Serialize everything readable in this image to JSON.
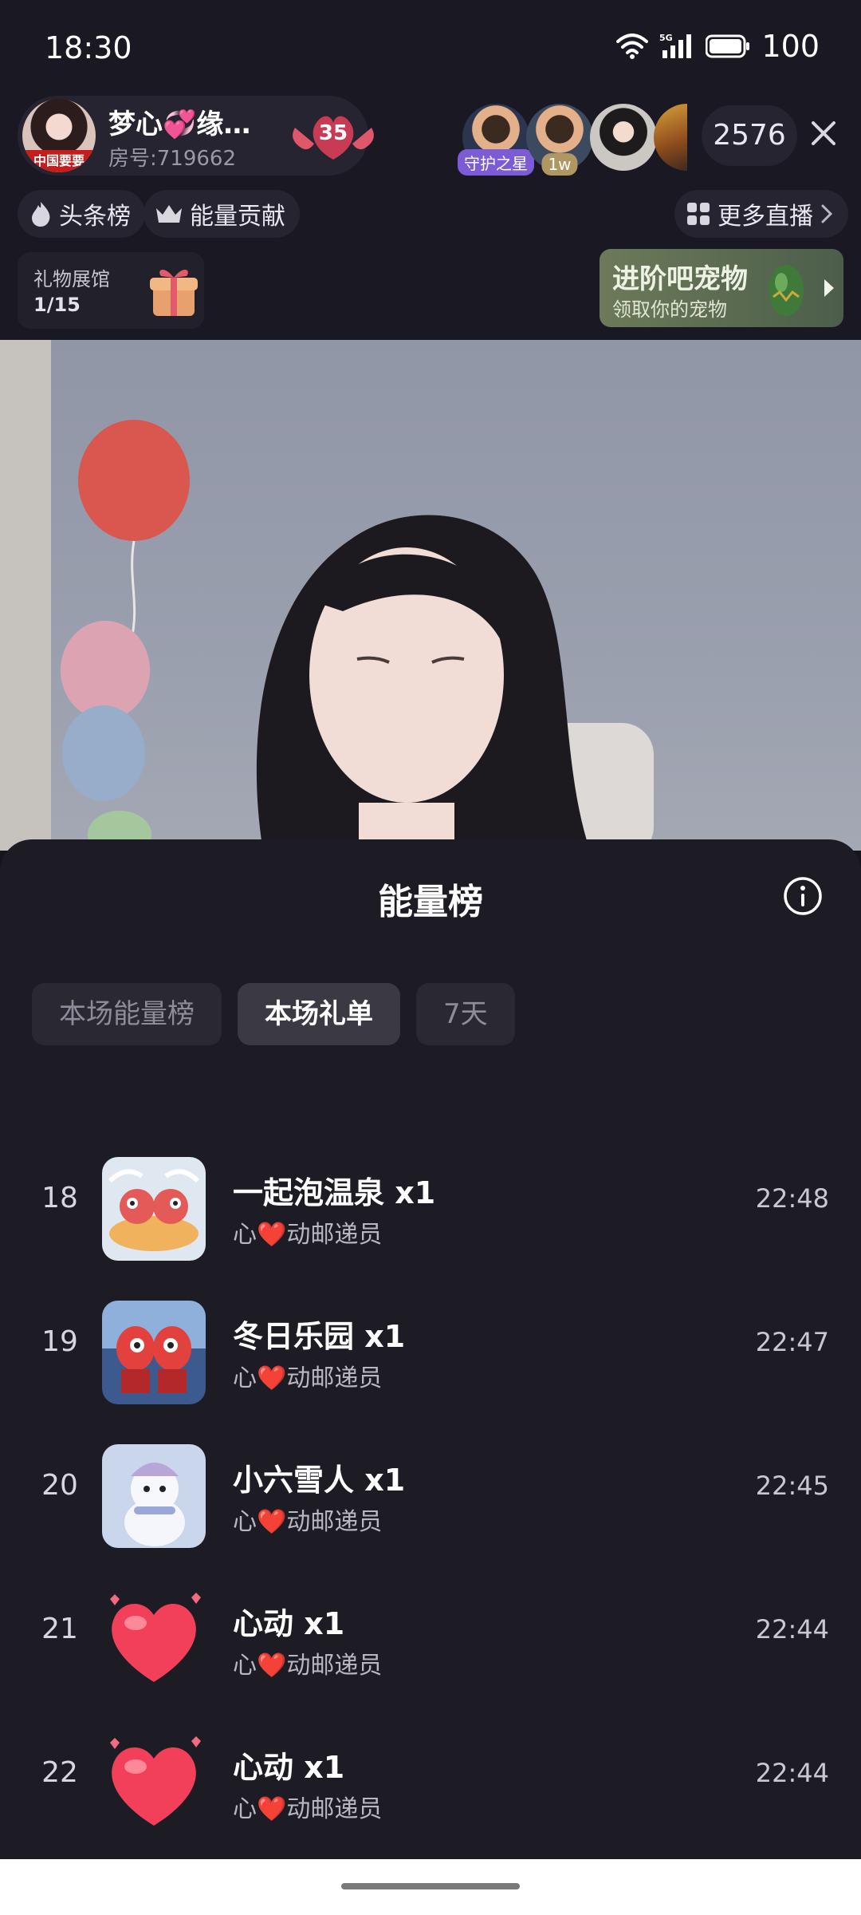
{
  "status_bar": {
    "time": "18:30",
    "battery": "100",
    "icons": [
      "wifi-icon",
      "signal-5g-icon",
      "battery-icon"
    ]
  },
  "header": {
    "host": {
      "name": "梦心💞缘…",
      "room": "房号:719662",
      "avatar_tag": "中国要要",
      "level": "35"
    },
    "viewers": [
      {
        "tag": "守护之星",
        "tag_color": "#7b5cd6"
      },
      {
        "tag": "1w",
        "tag_color": "#b09660"
      },
      {
        "tag": "",
        "tag_color": ""
      },
      {
        "tag": "",
        "tag_color": ""
      }
    ],
    "viewer_count": "2576",
    "chips": {
      "headline": "头条榜",
      "energy": "能量贡献",
      "more": "更多直播"
    },
    "gift_hall": {
      "title": "礼物展馆",
      "progress": "1/15"
    },
    "pet_banner": {
      "title": "进阶吧宠物",
      "subtitle": "领取你的宠物"
    }
  },
  "sheet": {
    "title": "能量榜",
    "tabs": [
      "本场能量榜",
      "本场礼单",
      "7天"
    ],
    "active_tab": "本场礼单",
    "rows": [
      {
        "rank": "18",
        "gift": "一起泡温泉  x1",
        "sender": "心❤️动邮递员",
        "time": "22:48",
        "icon": "hot-spring-gift-icon"
      },
      {
        "rank": "19",
        "gift": "冬日乐园  x1",
        "sender": "心❤️动邮递员",
        "time": "22:47",
        "icon": "winter-park-gift-icon"
      },
      {
        "rank": "20",
        "gift": "小六雪人  x1",
        "sender": "心❤️动邮递员",
        "time": "22:45",
        "icon": "snowman-gift-icon"
      },
      {
        "rank": "21",
        "gift": "心动  x1",
        "sender": "心❤️动邮递员",
        "time": "22:44",
        "icon": "heart-gift-icon"
      },
      {
        "rank": "22",
        "gift": "心动  x1",
        "sender": "心❤️动邮递员",
        "time": "22:44",
        "icon": "heart-gift-icon"
      }
    ]
  },
  "colors": {
    "background": "#16151b",
    "sheet": "#1d1c24",
    "tab_active": "#3a3944",
    "tab_inactive": "#2a2932"
  }
}
